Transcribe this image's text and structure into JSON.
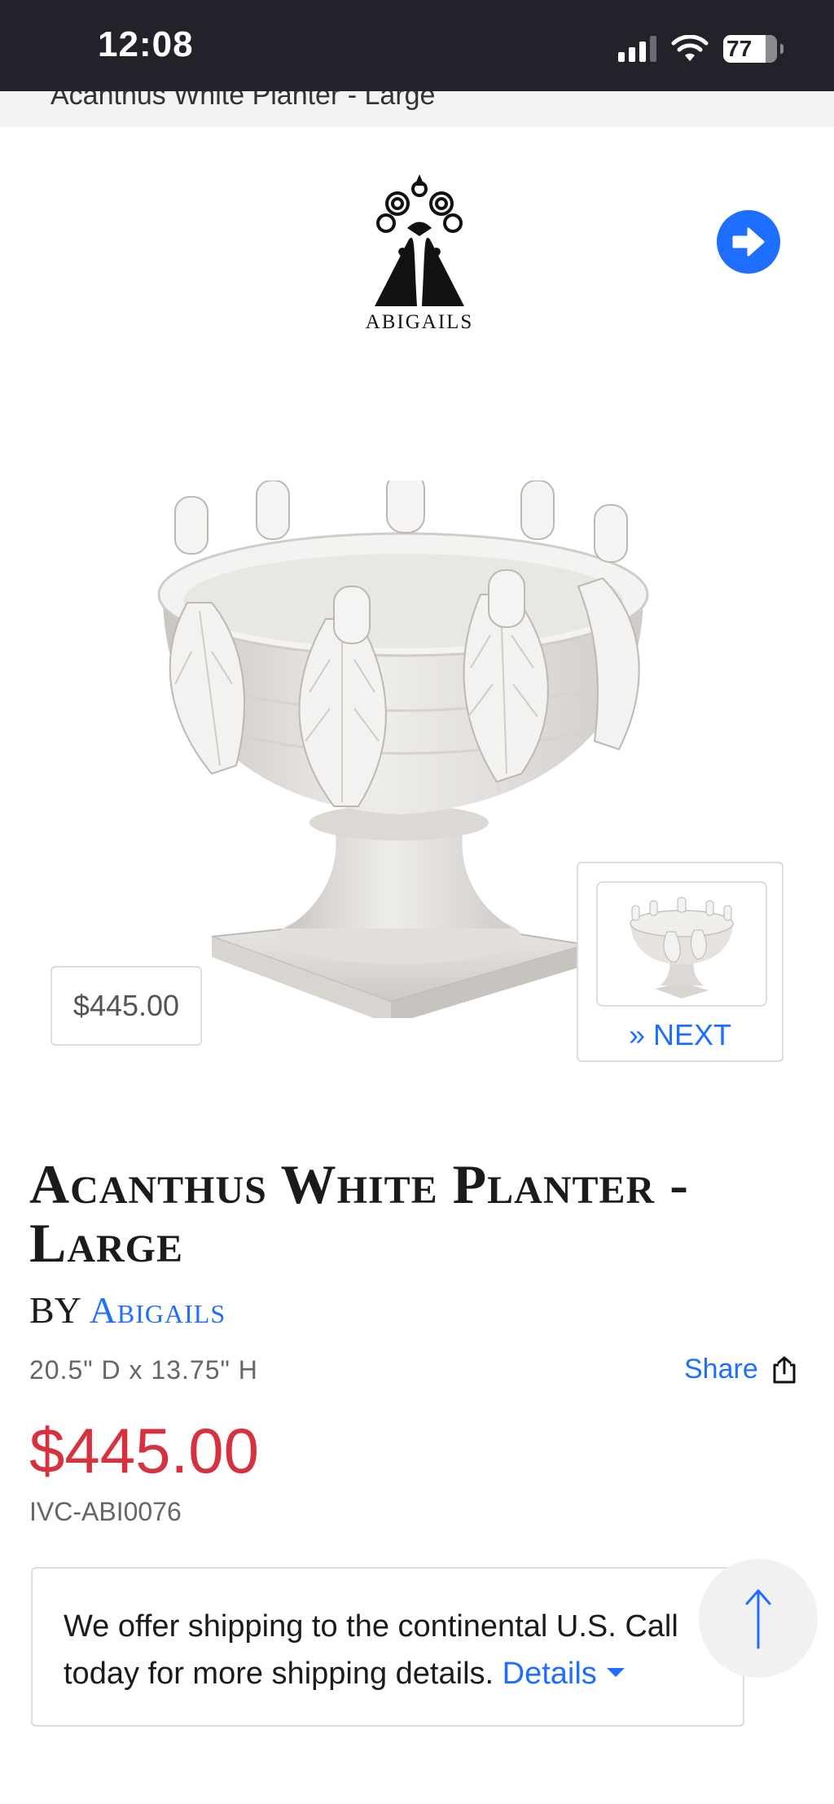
{
  "status_bar": {
    "time": "12:08",
    "battery": "77"
  },
  "breadcrumb": {
    "title": "Acanthus White Planter - Large"
  },
  "logo": {
    "wordmark": "ABIGAILS"
  },
  "gallery": {
    "price_tag": "$445.00",
    "next_label": "» NEXT"
  },
  "product": {
    "title": "Acanthus White Planter - Large",
    "by_prefix": "BY",
    "brand": "Abigails",
    "dimensions": "20.5\" D  x  13.75\" H",
    "share_label": "Share",
    "price": "$445.00",
    "sku": "IVC-ABI0076"
  },
  "shipping": {
    "text": "We offer shipping to the continental U.S. Call today for more shipping details.",
    "details_label": "Details"
  },
  "colors": {
    "accent": "#1e6fff",
    "price": "#d6313f",
    "status_bar": "#22232a"
  },
  "icons": [
    "wifi-icon",
    "signal-icon",
    "battery-icon",
    "arrow-right-circle-icon",
    "share-icon",
    "arrow-up-icon",
    "caret-down-icon"
  ]
}
